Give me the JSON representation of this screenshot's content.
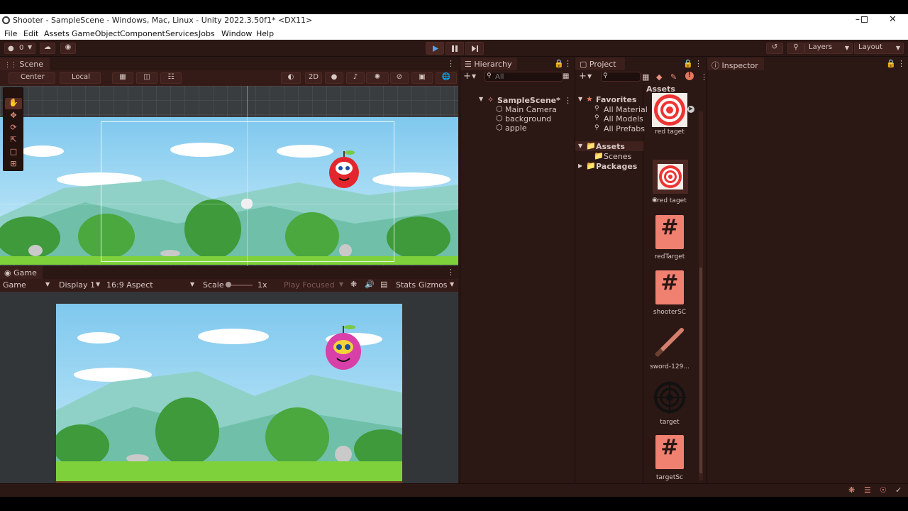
{
  "window_title": "Shooter - SampleScene - Windows, Mac, Linux - Unity 2022.3.50f1* <DX11>",
  "menu": [
    "File",
    "Edit",
    "Assets",
    "GameObject",
    "Component",
    "Services",
    "Jobs",
    "Window",
    "Help"
  ],
  "toolbar": {
    "account_count": "0",
    "layers_label": "Layers",
    "layout_label": "Layout"
  },
  "scene": {
    "tab": "Scene",
    "pivot": "Center",
    "space": "Local",
    "mode_2d": "2D"
  },
  "game": {
    "tab": "Game",
    "view": "Game",
    "display": "Display 1",
    "aspect": "16:9 Aspect",
    "scale_label": "Scale",
    "scale_value": "1x",
    "play_mode": "Play Focused",
    "stats": "Stats",
    "gizmos": "Gizmos"
  },
  "hierarchy": {
    "tab": "Hierarchy",
    "search_placeholder": "All",
    "scene_name": "SampleScene*",
    "items": [
      "Main Camera",
      "background",
      "apple"
    ]
  },
  "project": {
    "tab": "Project",
    "favorites_label": "Favorites",
    "favorites": [
      "All Material",
      "All Models",
      "All Prefabs"
    ],
    "assets_label": "Assets",
    "asset_folders": [
      "Scenes"
    ],
    "packages_label": "Packages",
    "grid_header": "Assets",
    "grid_items": [
      "red taget",
      "red taget",
      "redTarget",
      "shooterSC",
      "sword-129...",
      "target",
      "targetSc"
    ]
  },
  "inspector": {
    "tab": "Inspector"
  },
  "colors": {
    "accent": "#e07a5f",
    "panel": "#2b1714",
    "script_icon": "#f08070"
  }
}
